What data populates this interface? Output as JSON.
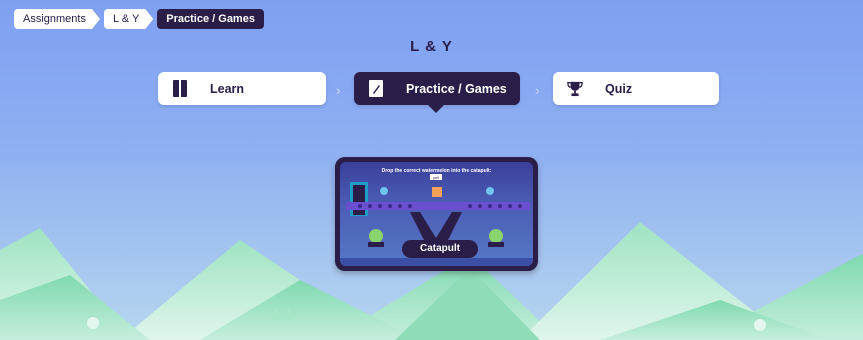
{
  "breadcrumb": {
    "items": [
      "Assignments",
      "L & Y",
      "Practice / Games"
    ]
  },
  "page": {
    "title": "L & Y"
  },
  "tabs": [
    {
      "label": "Learn",
      "icon": "book-icon",
      "active": false
    },
    {
      "label": "Practice / Games",
      "icon": "pencil-icon",
      "active": true
    },
    {
      "label": "Quiz",
      "icon": "trophy-icon",
      "active": false
    }
  ],
  "game": {
    "name": "Catapult",
    "prompt": "Drop the correct watermelon into the catapult:",
    "word": "yell"
  },
  "colors": {
    "dark": "#2a1d48",
    "sky_top": "#7f9ff2",
    "mountain": "#6fd1a4"
  }
}
